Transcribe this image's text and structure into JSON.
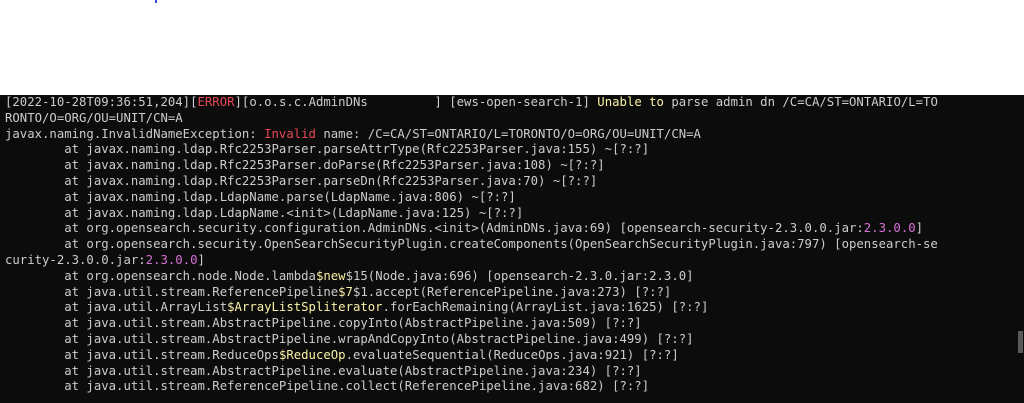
{
  "colors": {
    "terminal_bg": "#0c0c0c",
    "default_text": "#cccccc",
    "error_red": "#e74856",
    "highlight_yellow": "#f9f1a5",
    "magenta": "#d670d6"
  },
  "lines": [
    [
      {
        "t": "[2022-10-28T09:36:51,204]["
      },
      {
        "t": "ERROR",
        "c": "error"
      },
      {
        "t": "][o.o.s.c.AdminDNs         ] [ews-open-search-1] "
      },
      {
        "t": "Unable to",
        "c": "warn"
      },
      {
        "t": " parse admin dn /C=CA/ST=ONTARIO/L=TO"
      }
    ],
    [
      {
        "t": "RONTO/O=ORG/OU=UNIT/CN=A"
      }
    ],
    [
      {
        "t": "javax.naming.InvalidNameException: "
      },
      {
        "t": "Invalid",
        "c": "kw"
      },
      {
        "t": " name: /C=CA/ST=ONTARIO/L=TORONTO/O=ORG/OU=UNIT/CN=A"
      }
    ],
    [
      {
        "t": "        at javax.naming.ldap.Rfc2253Parser.parseAttrType(Rfc2253Parser.java:155) ~[?:?]"
      }
    ],
    [
      {
        "t": "        at javax.naming.ldap.Rfc2253Parser.doParse(Rfc2253Parser.java:108) ~[?:?]"
      }
    ],
    [
      {
        "t": "        at javax.naming.ldap.Rfc2253Parser.parseDn(Rfc2253Parser.java:70) ~[?:?]"
      }
    ],
    [
      {
        "t": "        at javax.naming.ldap.LdapName.parse(LdapName.java:806) ~[?:?]"
      }
    ],
    [
      {
        "t": "        at javax.naming.ldap.LdapName.<init>(LdapName.java:125) ~[?:?]"
      }
    ],
    [
      {
        "t": "        at org.opensearch.security.configuration.AdminDNs.<init>(AdminDNs.java:69) [opensearch-security-2.3.0.0.jar:"
      },
      {
        "t": "2.3.0.0",
        "c": "mag"
      },
      {
        "t": "]"
      }
    ],
    [
      {
        "t": "        at org.opensearch.security.OpenSearchSecurityPlugin.createComponents(OpenSearchSecurityPlugin.java:797) [opensearch-se"
      }
    ],
    [
      {
        "t": "curity-2.3.0.0.jar:"
      },
      {
        "t": "2.3.0.0",
        "c": "mag"
      },
      {
        "t": "]"
      }
    ],
    [
      {
        "t": "        at org.opensearch.node.Node.lambda"
      },
      {
        "t": "$new",
        "c": "warn"
      },
      {
        "t": "$15(Node.java:696) [opensearch-2.3.0.jar:2.3.0]"
      }
    ],
    [
      {
        "t": "        at java.util.stream.ReferencePipeline"
      },
      {
        "t": "$7",
        "c": "warn"
      },
      {
        "t": "$1.accept(ReferencePipeline.java:273) [?:?]"
      }
    ],
    [
      {
        "t": "        at java.util.ArrayList"
      },
      {
        "t": "$ArrayListSpliterator",
        "c": "warn"
      },
      {
        "t": ".forEachRemaining(ArrayList.java:1625) [?:?]"
      }
    ],
    [
      {
        "t": "        at java.util.stream.AbstractPipeline.copyInto(AbstractPipeline.java:509) [?:?]"
      }
    ],
    [
      {
        "t": "        at java.util.stream.AbstractPipeline.wrapAndCopyInto(AbstractPipeline.java:499) [?:?]"
      }
    ],
    [
      {
        "t": "        at java.util.stream.ReduceOps"
      },
      {
        "t": "$ReduceOp",
        "c": "warn"
      },
      {
        "t": ".evaluateSequential(ReduceOps.java:921) [?:?]"
      }
    ],
    [
      {
        "t": "        at java.util.stream.AbstractPipeline.evaluate(AbstractPipeline.java:234) [?:?]"
      }
    ],
    [
      {
        "t": "        at java.util.stream.ReferencePipeline.collect(ReferencePipeline.java:682) [?:?]"
      }
    ]
  ]
}
